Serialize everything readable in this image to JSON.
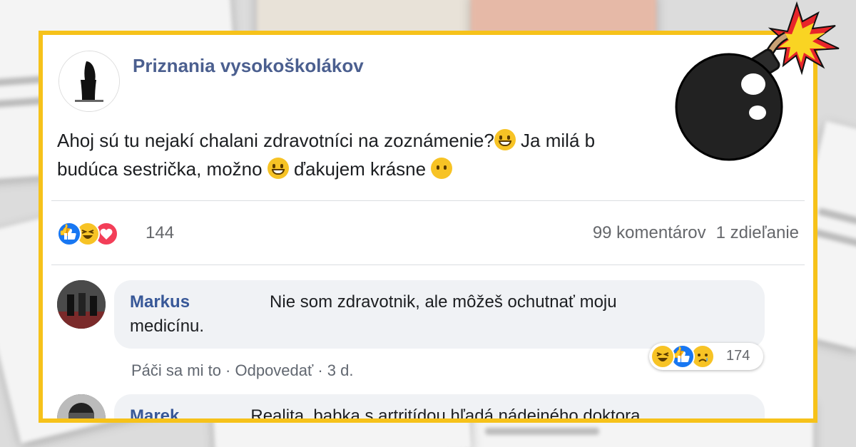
{
  "post": {
    "page_name": "Priznania vysokoškolákov",
    "text_line1": "Ahoj sú tu nejakí chalani zdravotníci na zoznámenie?",
    "text_line1_tail": " Ja milá b",
    "text_line2_a": "budúca sestrička, možno ",
    "text_line2_b": " ďakujem krásne ",
    "reaction_count": "144",
    "comments_count": "99 komentárov",
    "shares_count": "1 zdieľanie"
  },
  "comments": [
    {
      "author": "Markus",
      "text": "Nie som zdravotnik, ale môžeš ochutnať moju",
      "text_cont": "medicínu.",
      "actions": "Páči sa mi to · Odpovedať · 3 d.",
      "reaction_count": "174"
    },
    {
      "author": "Marek",
      "text": "Realita, babka s artritídou hľadá nádejného doktora"
    }
  ],
  "colors": {
    "frame": "#f6c21a",
    "author": "#385898",
    "page_name": "#4b5f8f",
    "like": "#1877f2",
    "love": "#f33e58",
    "haha": "#f7c325"
  },
  "icons": [
    "like-reaction-icon",
    "haha-reaction-icon",
    "love-reaction-icon",
    "sad-reaction-icon",
    "grin-emoji",
    "no-mouth-emoji",
    "bomb-icon"
  ]
}
